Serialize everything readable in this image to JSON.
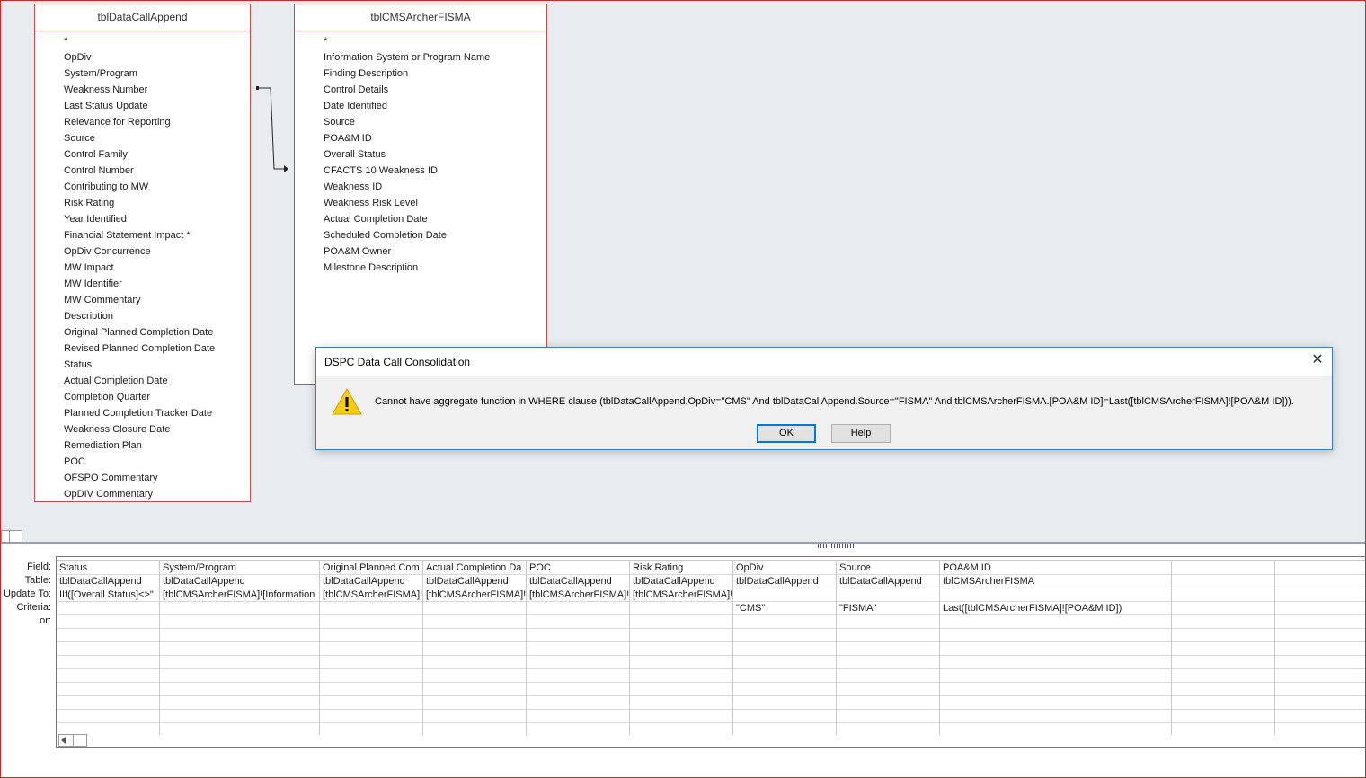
{
  "table1": {
    "name": "tblDataCallAppend",
    "fields": [
      "*",
      "OpDiv",
      "System/Program",
      "Weakness  Number",
      "Last Status Update",
      "Relevance for Reporting",
      "Source",
      "Control Family",
      "Control Number",
      "Contributing to MW",
      "Risk Rating",
      "Year Identified",
      "Financial Statement Impact *",
      "OpDiv Concurrence",
      "MW Impact",
      "MW Identifier",
      "MW Commentary",
      "Description",
      "Original Planned Completion Date",
      "Revised Planned Completion Date",
      "Status",
      "Actual Completion Date",
      "Completion Quarter",
      "Planned Completion Tracker Date",
      "Weakness Closure Date",
      "Remediation Plan",
      "POC",
      "OFSPO Commentary",
      "OpDIV Commentary"
    ]
  },
  "table2": {
    "name": "tblCMSArcherFISMA",
    "fields": [
      "*",
      "Information System or Program Name",
      "Finding Description",
      "Control Details",
      "Date Identified",
      "Source",
      "POA&M ID",
      "Overall Status",
      "CFACTS 10 Weakness ID",
      "Weakness ID",
      "Weakness Risk Level",
      "Actual Completion Date",
      "Scheduled Completion Date",
      "POA&M Owner",
      "Milestone Description"
    ]
  },
  "grid": {
    "row_labels": [
      "Field:",
      "Table:",
      "Update To:",
      "Criteria:",
      "or:"
    ],
    "columns": [
      {
        "field": "Status",
        "table": "tblDataCallAppend",
        "update_to": "IIf([Overall Status]<>\"",
        "criteria": ""
      },
      {
        "field": "System/Program",
        "table": "tblDataCallAppend",
        "update_to": "[tblCMSArcherFISMA]![Information",
        "criteria": ""
      },
      {
        "field": "Original Planned Com",
        "table": "tblDataCallAppend",
        "update_to": "[tblCMSArcherFISMA]!",
        "criteria": ""
      },
      {
        "field": "Actual Completion Da",
        "table": "tblDataCallAppend",
        "update_to": "[tblCMSArcherFISMA]!",
        "criteria": ""
      },
      {
        "field": "POC",
        "table": "tblDataCallAppend",
        "update_to": "[tblCMSArcherFISMA]!",
        "criteria": ""
      },
      {
        "field": "Risk Rating",
        "table": "tblDataCallAppend",
        "update_to": "[tblCMSArcherFISMA]!",
        "criteria": ""
      },
      {
        "field": "OpDiv",
        "table": "tblDataCallAppend",
        "update_to": "",
        "criteria": "\"CMS\""
      },
      {
        "field": "Source",
        "table": "tblDataCallAppend",
        "update_to": "",
        "criteria": "\"FISMA\""
      },
      {
        "field": "POA&M ID",
        "table": "tblCMSArcherFISMA",
        "update_to": "",
        "criteria": "Last([tblCMSArcherFISMA]![POA&M ID])"
      },
      {
        "field": "",
        "table": "",
        "update_to": "",
        "criteria": ""
      },
      {
        "field": "",
        "table": "",
        "update_to": "",
        "criteria": ""
      }
    ]
  },
  "dialog": {
    "title": "DSPC Data Call Consolidation",
    "message": "Cannot have aggregate function in WHERE clause (tblDataCallAppend.OpDiv=\"CMS\" And tblDataCallAppend.Source=\"FISMA\" And tblCMSArcherFISMA.[POA&M ID]=Last([tblCMSArcherFISMA]![POA&M ID])).",
    "ok_label": "OK",
    "help_label": "Help",
    "close_glyph": "✕",
    "icon": "warning-icon"
  }
}
